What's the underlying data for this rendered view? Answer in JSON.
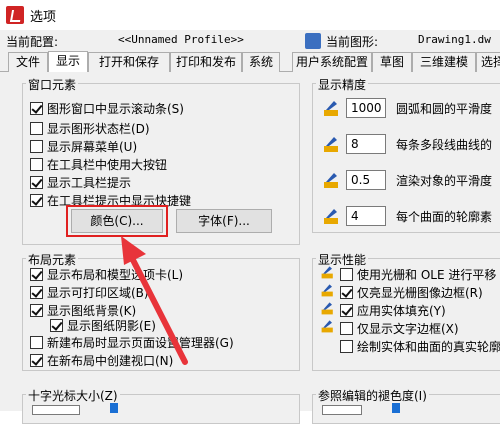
{
  "window": {
    "title": "选项"
  },
  "profile": {
    "current_config_label": "当前配置:",
    "current_config_value": "<<Unnamed Profile>>",
    "current_drawing_label": "当前图形:",
    "current_drawing_value": "Drawing1.dw"
  },
  "tabs": [
    "文件",
    "显示",
    "打开和保存",
    "打印和发布",
    "系统",
    "用户系统配置",
    "草图",
    "三维建模",
    "选择"
  ],
  "active_tab": "显示",
  "window_elements": {
    "title": "窗口元素",
    "options": [
      {
        "label": "图形窗口中显示滚动条(S)",
        "checked": true
      },
      {
        "label": "显示图形状态栏(D)",
        "checked": false
      },
      {
        "label": "显示屏幕菜单(U)",
        "checked": false
      },
      {
        "label": "在工具栏中使用大按钮",
        "checked": false
      },
      {
        "label": "显示工具栏提示",
        "checked": true
      },
      {
        "label": "在工具栏提示中显示快捷键",
        "checked": true
      }
    ],
    "color_button": "颜色(C)...",
    "font_button": "字体(F)..."
  },
  "layout_elements": {
    "title": "布局元素",
    "options": [
      {
        "label": "显示布局和模型选项卡(L)",
        "checked": true
      },
      {
        "label": "显示可打印区域(B)",
        "checked": true
      },
      {
        "label": "显示图纸背景(K)",
        "checked": true
      },
      {
        "label": "显示图纸阴影(E)",
        "checked": true
      },
      {
        "label": "新建布局时显示页面设置管理器(G)",
        "checked": false
      },
      {
        "label": "在新布局中创建视口(N)",
        "checked": true
      }
    ]
  },
  "crosshair": {
    "title": "十字光标大小(Z)"
  },
  "display_resolution": {
    "title": "显示精度",
    "items": [
      {
        "value": "1000",
        "label": "圆弧和圆的平滑度"
      },
      {
        "value": "8",
        "label": "每条多段线曲线的"
      },
      {
        "value": "0.5",
        "label": "渲染对象的平滑度"
      },
      {
        "value": "4",
        "label": "每个曲面的轮廓素"
      }
    ]
  },
  "display_performance": {
    "title": "显示性能",
    "options": [
      {
        "label": "使用光栅和 OLE 进行平移",
        "checked": false
      },
      {
        "label": "仅亮显光栅图像边框(R)",
        "checked": true
      },
      {
        "label": "应用实体填充(Y)",
        "checked": true
      },
      {
        "label": "仅显示文字边框(X)",
        "checked": false
      },
      {
        "label": "绘制实体和曲面的真实轮廓",
        "checked": false
      }
    ]
  },
  "xref": {
    "title": "参照编辑的褪色度(I)"
  },
  "colors": {
    "highlight_frame": "#e02020",
    "arrow": "#e8343a",
    "tab_border": "#adadad"
  }
}
